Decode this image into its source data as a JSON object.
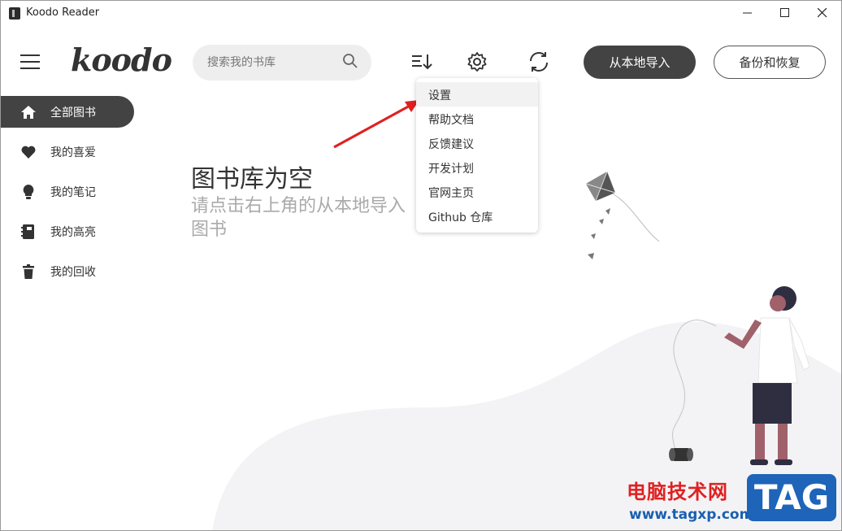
{
  "window": {
    "title": "Koodo Reader"
  },
  "header": {
    "logo": "koodo",
    "search_placeholder": "搜索我的书库",
    "import_label": "从本地导入",
    "backup_label": "备份和恢复"
  },
  "sidebar": {
    "items": [
      {
        "label": "全部图书",
        "icon": "home-icon",
        "active": true
      },
      {
        "label": "我的喜爱",
        "icon": "heart-icon",
        "active": false
      },
      {
        "label": "我的笔记",
        "icon": "lightbulb-icon",
        "active": false
      },
      {
        "label": "我的高亮",
        "icon": "notebook-icon",
        "active": false
      },
      {
        "label": "我的回收",
        "icon": "trash-icon",
        "active": false
      }
    ]
  },
  "empty_state": {
    "title": "图书库为空",
    "subtitle": "请点击右上角的从本地导入图书"
  },
  "settings_menu": {
    "items": [
      "设置",
      "帮助文档",
      "反馈建议",
      "开发计划",
      "官网主页",
      "Github 仓库"
    ]
  },
  "watermark": {
    "text": "电脑技术网",
    "url": "www.tagxp.com",
    "badge": "TAG"
  },
  "colors": {
    "accent": "#434343",
    "arrow": "#e02020"
  }
}
